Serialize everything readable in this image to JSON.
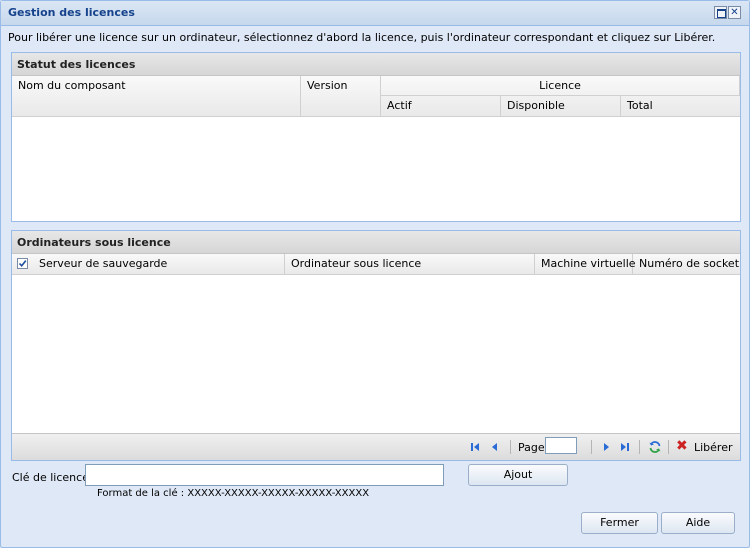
{
  "window": {
    "title": "Gestion des licences"
  },
  "instructions": "Pour libérer une licence sur un ordinateur, sélectionnez d'abord la licence, puis l'ordinateur correspondant et cliquez sur Libérer.",
  "license_status": {
    "title": "Statut des licences",
    "columns": {
      "component": "Nom du composant",
      "version": "Version",
      "licence_group": "Licence",
      "active": "Actif",
      "available": "Disponible",
      "total": "Total"
    },
    "rows": []
  },
  "licensed_computers": {
    "title": "Ordinateurs sous licence",
    "columns": {
      "backup_server": "Serveur de sauvegarde",
      "licensed_computer": "Ordinateur sous licence",
      "virtual_machine": "Machine virtuelle",
      "socket_number": "Numéro de socket"
    },
    "select_all_checked": true,
    "rows": []
  },
  "pager": {
    "page_label": "Page",
    "page_value": "",
    "release_label": "Libérer"
  },
  "license_key": {
    "label": "Clé de licence",
    "value": "",
    "format_hint": "Format de la clé : XXXXX-XXXXX-XXXXX-XXXXX-XXXXX",
    "add_label": "Ajout"
  },
  "footer": {
    "close_label": "Fermer",
    "help_label": "Aide"
  },
  "colors": {
    "title_text": "#15428b",
    "border": "#99bbe8",
    "window_bg": "#dfe8f6",
    "release_icon": "#cc2222",
    "pager_icon": "#2a6bd6"
  }
}
